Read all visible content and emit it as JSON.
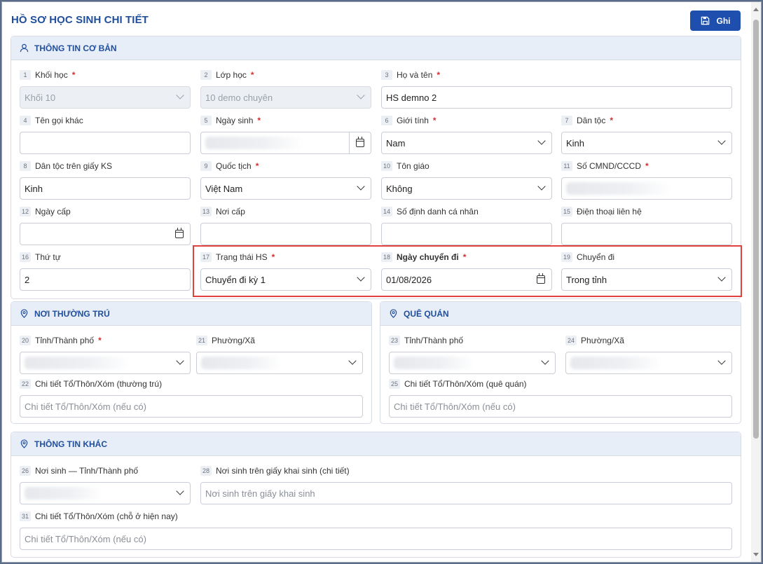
{
  "title": "HỒ SƠ HỌC SINH CHI TIẾT",
  "save_label": "Ghi",
  "sections": {
    "basic": "THÔNG TIN CƠ BẢN",
    "residence": "NƠI THƯỜNG TRÚ",
    "hometown": "QUÊ QUÁN",
    "other": "THÔNG TIN KHÁC"
  },
  "fields": {
    "f1": {
      "num": "1",
      "label": "Khối học",
      "value": "Khối 10"
    },
    "f2": {
      "num": "2",
      "label": "Lớp học",
      "value": "10 demo chuyên"
    },
    "f3": {
      "num": "3",
      "label": "Họ và tên",
      "value": "HS demno 2"
    },
    "f4": {
      "num": "4",
      "label": "Tên gọi khác",
      "value": ""
    },
    "f5": {
      "num": "5",
      "label": "Ngày sinh",
      "value": ""
    },
    "f6": {
      "num": "6",
      "label": "Giới tính",
      "value": "Nam"
    },
    "f7": {
      "num": "7",
      "label": "Dân tộc",
      "value": "Kinh"
    },
    "f8": {
      "num": "8",
      "label": "Dân tộc trên giấy KS",
      "value": "Kinh"
    },
    "f9": {
      "num": "9",
      "label": "Quốc tịch",
      "value": "Việt Nam"
    },
    "f10": {
      "num": "10",
      "label": "Tôn giáo",
      "value": "Không"
    },
    "f11": {
      "num": "11",
      "label": "Số CMND/CCCD",
      "value": ""
    },
    "f12": {
      "num": "12",
      "label": "Ngày cấp",
      "value": ""
    },
    "f13": {
      "num": "13",
      "label": "Nơi cấp",
      "value": ""
    },
    "f14": {
      "num": "14",
      "label": "Số định danh cá nhân",
      "value": ""
    },
    "f15": {
      "num": "15",
      "label": "Điện thoại liên hệ",
      "value": ""
    },
    "f16": {
      "num": "16",
      "label": "Thứ tự",
      "value": "2"
    },
    "f17": {
      "num": "17",
      "label": "Trạng thái HS",
      "value": "Chuyển đi kỳ 1"
    },
    "f18": {
      "num": "18",
      "label": "Ngày chuyển đi",
      "value": "01/08/2026"
    },
    "f19": {
      "num": "19",
      "label": "Chuyển đi",
      "value": "Trong tỉnh"
    },
    "f20": {
      "num": "20",
      "label": "Tỉnh/Thành phố",
      "value": ""
    },
    "f21": {
      "num": "21",
      "label": "Phường/Xã",
      "value": ""
    },
    "f22": {
      "num": "22",
      "label": "Chi tiết Tổ/Thôn/Xóm (thường trú)",
      "placeholder": "Chi tiết Tổ/Thôn/Xóm (nếu có)"
    },
    "f23": {
      "num": "23",
      "label": "Tỉnh/Thành phố",
      "value": ""
    },
    "f24": {
      "num": "24",
      "label": "Phường/Xã",
      "value": ""
    },
    "f25": {
      "num": "25",
      "label": "Chi tiết Tổ/Thôn/Xóm (quê quán)",
      "placeholder": "Chi tiết Tổ/Thôn/Xóm (nếu có)"
    },
    "f26": {
      "num": "26",
      "label": "Nơi sinh — Tỉnh/Thành phố",
      "value": ""
    },
    "f28": {
      "num": "28",
      "label": "Nơi sinh trên giấy khai sinh (chi tiết)",
      "placeholder": "Nơi sinh trên giấy khai sinh"
    },
    "f31": {
      "num": "31",
      "label": "Chi tiết Tổ/Thôn/Xóm (chỗ ở hiện nay)",
      "placeholder": "Chi tiết Tổ/Thôn/Xóm (nếu có)"
    }
  },
  "required_mark": "*",
  "colors": {
    "accent": "#1f4e9d",
    "button": "#1e4fae",
    "highlight": "#e0413c",
    "required": "#d32f2f"
  }
}
